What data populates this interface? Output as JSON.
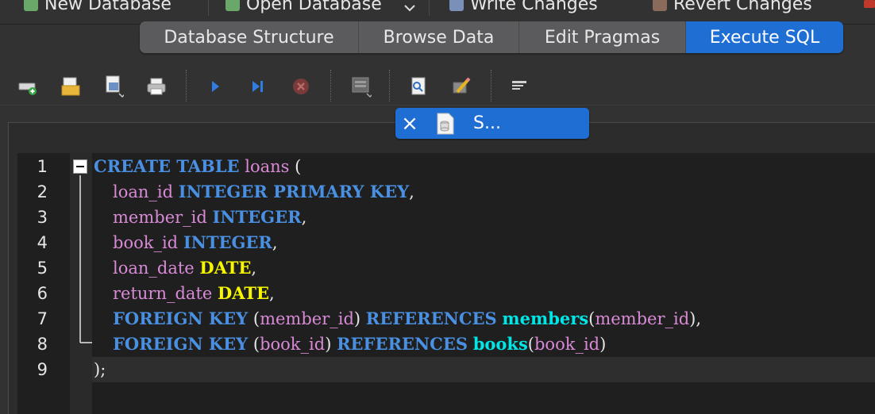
{
  "main_toolbar": {
    "new_database": "New Database",
    "open_database": "Open Database",
    "write_changes": "Write Changes",
    "revert_changes": "Revert Changes"
  },
  "tabs": [
    {
      "label": "Database Structure",
      "active": false
    },
    {
      "label": "Browse Data",
      "active": false
    },
    {
      "label": "Edit Pragmas",
      "active": false
    },
    {
      "label": "Execute SQL",
      "active": true
    }
  ],
  "sql_toolbar": {
    "buttons": [
      "open-tab-icon",
      "open-sql-file-icon",
      "save-sql-file-icon",
      "print-icon",
      "execute-all-icon",
      "execute-line-icon",
      "stop-execution-icon",
      "save-results-icon",
      "find-icon",
      "find-replace-icon",
      "comment-toggle-icon"
    ]
  },
  "editor_tab": {
    "name": "S..."
  },
  "line_numbers": [
    "1",
    "2",
    "3",
    "4",
    "5",
    "6",
    "7",
    "8",
    "9"
  ],
  "code": {
    "l1": {
      "kw": "CREATE TABLE",
      "name": "loans",
      "open": "("
    },
    "l2": {
      "col": "loan_id",
      "type": "INTEGER PRIMARY KEY",
      "end": ","
    },
    "l3": {
      "col": "member_id",
      "type": "INTEGER",
      "end": ","
    },
    "l4": {
      "col": "book_id",
      "type": "INTEGER",
      "end": ","
    },
    "l5": {
      "col": "loan_date",
      "type": "DATE",
      "end": ","
    },
    "l6": {
      "col": "return_date",
      "type": "DATE",
      "end": ","
    },
    "l7": {
      "fk": "FOREIGN KEY",
      "lp": "(",
      "col": "member_id",
      "rp": ")",
      "ref": "REFERENCES",
      "table": "members",
      "lp2": "(",
      "col2": "member_id",
      "rp2": ")",
      "end": ","
    },
    "l8": {
      "fk": "FOREIGN KEY",
      "lp": "(",
      "col": "book_id",
      "rp": ")",
      "ref": "REFERENCES",
      "table": "books",
      "lp2": "(",
      "col2": "book_id",
      "rp2": ")"
    },
    "l9": {
      "close": ");"
    }
  },
  "colors": {
    "accent": "#1f6ed4",
    "keyword": "#4a90e2",
    "identifier": "#d98ad6",
    "datatype": "#f7f700",
    "table_ref": "#00e5e5"
  }
}
